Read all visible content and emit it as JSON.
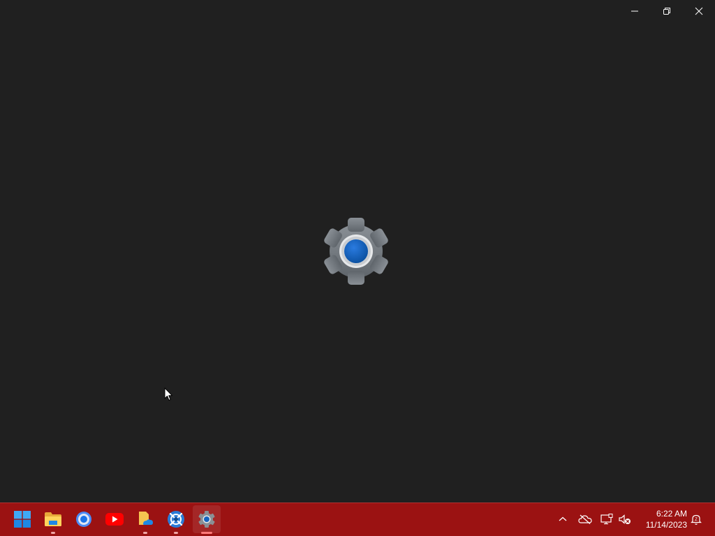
{
  "window": {
    "app": "Settings",
    "caption_buttons": [
      "minimize",
      "restore",
      "close"
    ]
  },
  "splash": {
    "icon": "gear-icon",
    "accent_color": "#0f5fb5"
  },
  "taskbar": {
    "color": "#9b1212",
    "apps": [
      {
        "name": "Start",
        "icon": "windows-start-icon",
        "running": false
      },
      {
        "name": "File Explorer",
        "icon": "folder-icon",
        "running": true
      },
      {
        "name": "Google Chrome",
        "icon": "chrome-icon",
        "running": false
      },
      {
        "name": "YouTube",
        "icon": "youtube-icon",
        "running": false
      },
      {
        "name": "OneDrive file",
        "icon": "onedrive-file-icon",
        "running": true
      },
      {
        "name": "App",
        "icon": "compass-app-icon",
        "running": true
      },
      {
        "name": "Settings",
        "icon": "gear-icon",
        "running": true,
        "active": true
      }
    ],
    "tray": {
      "icons": [
        "chevron-up-icon",
        "onedrive-cloud-icon",
        "network-icon",
        "volume-muted-icon"
      ],
      "time": "6:22 AM",
      "date": "11/14/2023",
      "notification_icon": "notification-bell-icon"
    }
  }
}
